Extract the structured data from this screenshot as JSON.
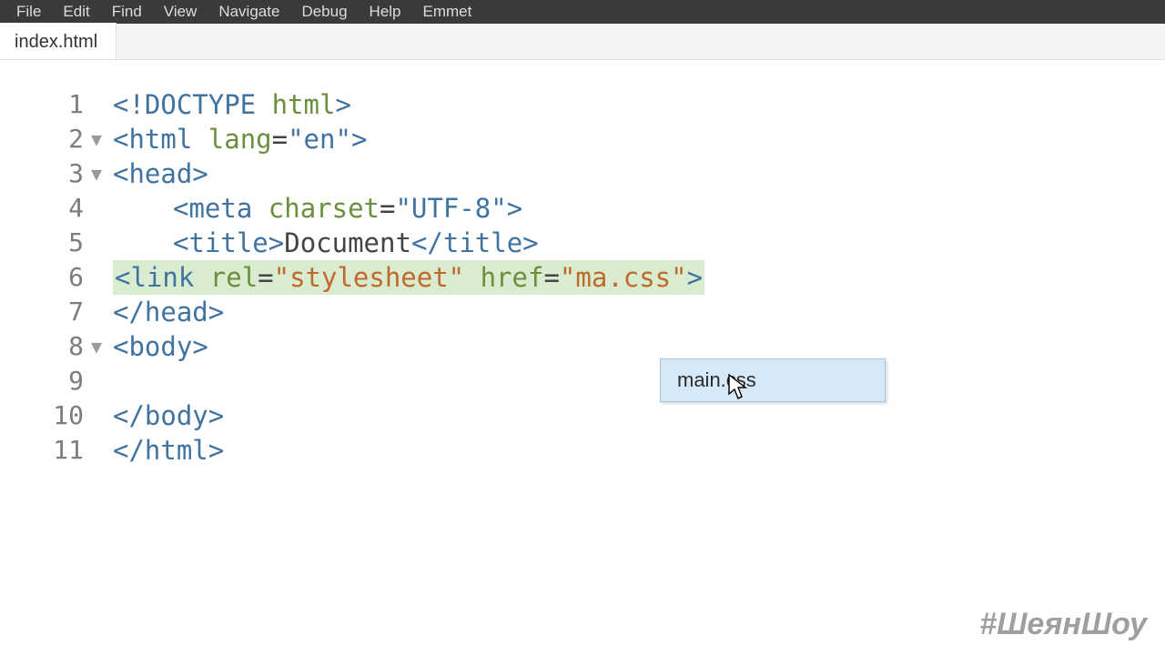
{
  "menu": {
    "file": "File",
    "edit": "Edit",
    "find": "Find",
    "view": "View",
    "navigate": "Navigate",
    "debug": "Debug",
    "help": "Help",
    "emmet": "Emmet"
  },
  "tab": {
    "name": "index.html"
  },
  "gutter": [
    "1",
    "2",
    "3",
    "4",
    "5",
    "6",
    "7",
    "8",
    "9",
    "10",
    "11"
  ],
  "code": {
    "l1_a": "<!DOCTYPE",
    "l1_b": " html",
    "l1_c": ">",
    "l2_a": "<",
    "l2_b": "html",
    "l2_c": " lang",
    "l2_d": "=",
    "l2_e": "\"en\"",
    "l2_f": ">",
    "l3_a": "<",
    "l3_b": "head",
    "l3_c": ">",
    "l4_a": "<",
    "l4_b": "meta",
    "l4_c": " charset",
    "l4_d": "=",
    "l4_e": "\"UTF-8\"",
    "l4_f": ">",
    "l5_a": "<",
    "l5_b": "title",
    "l5_c": ">",
    "l5_d": "Document",
    "l5_e": "</",
    "l5_f": "title",
    "l5_g": ">",
    "l6_a": "<",
    "l6_b": "link",
    "l6_c": " rel",
    "l6_d": "=",
    "l6_e": "\"stylesheet\"",
    "l6_f": " href",
    "l6_g": "=",
    "l6_h": "\"ma.css\"",
    "l6_i": ">",
    "l7_a": "</",
    "l7_b": "head",
    "l7_c": ">",
    "l8_a": "<",
    "l8_b": "body",
    "l8_c": ">",
    "l10_a": "</",
    "l10_b": "body",
    "l10_c": ">",
    "l11_a": "</",
    "l11_b": "html",
    "l11_c": ">"
  },
  "fold": {
    "down": "▼"
  },
  "autocomplete": {
    "item1": "main.css"
  },
  "watermark": "#ШеянШоу"
}
